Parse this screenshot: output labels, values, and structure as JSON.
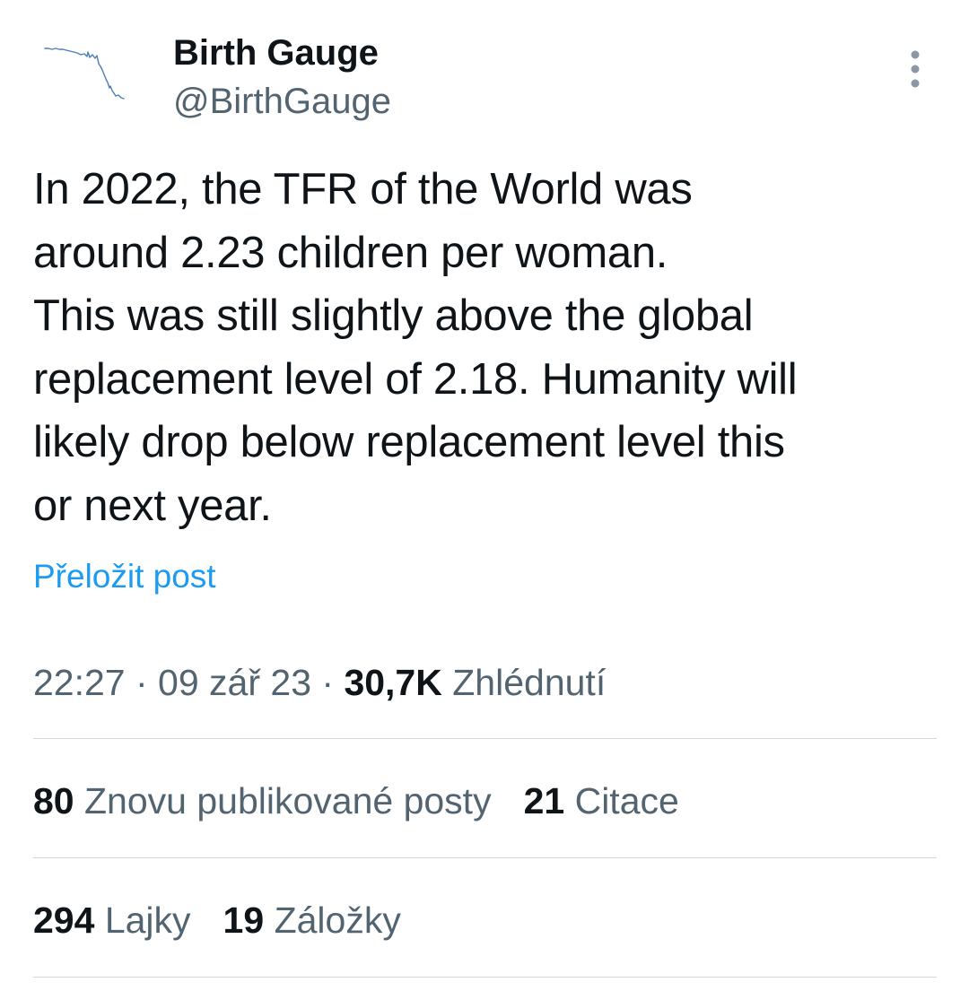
{
  "author": {
    "name": "Birth Gauge",
    "handle": "@BirthGauge",
    "avatar_icon": "declining-line-chart-icon"
  },
  "more_icon": "more-vertical-icon",
  "tweet": {
    "text": "In 2022, the TFR of the World was\naround 2.23 children per woman.\nThis was still slightly above the global\nreplacement level of 2.18. Humanity will\nlikely drop below replacement level this\nor next year.",
    "translate_label": "Přeložit post"
  },
  "meta": {
    "time": "22:27",
    "separator": " · ",
    "date": "09 zář 23",
    "views_count": "30,7K",
    "views_label": "Zhlédnutí"
  },
  "stats_row1": [
    {
      "count": "80",
      "label": "Znovu publikované posty"
    },
    {
      "count": "21",
      "label": "Citace"
    }
  ],
  "stats_row2": [
    {
      "count": "294",
      "label": "Lajky"
    },
    {
      "count": "19",
      "label": "Záložky"
    }
  ],
  "colors": {
    "text_primary": "#0f1419",
    "text_secondary": "#536471",
    "link": "#1d9bf0",
    "divider": "#cfd9de",
    "avatar_line": "#4a7fb5"
  }
}
